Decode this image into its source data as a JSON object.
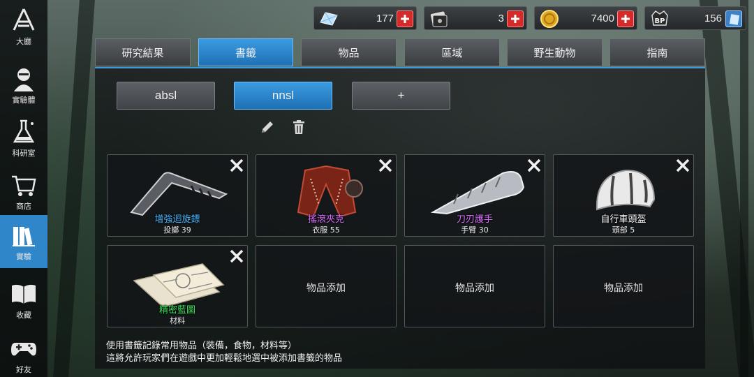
{
  "sidebar": {
    "items": [
      {
        "label": "大廳",
        "icon": "lobby-logo-icon"
      },
      {
        "label": "實驗體",
        "icon": "subject-portrait-icon"
      },
      {
        "label": "科研室",
        "icon": "flask-icon"
      },
      {
        "label": "商店",
        "icon": "shopping-cart-icon"
      },
      {
        "label": "實驗",
        "icon": "books-icon",
        "active": true
      },
      {
        "label": "收藏",
        "icon": "open-book-icon"
      },
      {
        "label": "好友",
        "icon": "gamepad-icon"
      }
    ]
  },
  "currency": [
    {
      "name": "crystal",
      "icon": "crystal-icon",
      "value": "177",
      "has_plus": true
    },
    {
      "name": "ticket",
      "icon": "ticket-card-icon",
      "value": "3",
      "has_plus": true
    },
    {
      "name": "coin",
      "icon": "gold-coin-icon",
      "value": "7400",
      "has_plus": true
    },
    {
      "name": "bp",
      "icon": "bp-badge-icon",
      "value": "156",
      "has_plus": false
    }
  ],
  "tabs": [
    {
      "label": "研究結果"
    },
    {
      "label": "書籤",
      "active": true
    },
    {
      "label": "物品"
    },
    {
      "label": "區域"
    },
    {
      "label": "野生動物"
    },
    {
      "label": "指南"
    }
  ],
  "bookmark_buttons": [
    {
      "label": "absl"
    },
    {
      "label": "nnsl",
      "active": true
    },
    {
      "label": "+"
    }
  ],
  "slots": [
    {
      "name": "增強迴旋鏢",
      "name_color": "#46b8ff",
      "sub": "投擲 39",
      "art": "boomerang"
    },
    {
      "name": "搖滾夾克",
      "name_color": "#d86bff",
      "sub": "衣服 55",
      "art": "jacket"
    },
    {
      "name": "刀刃護手",
      "name_color": "#d86bff",
      "sub": "手臂 30",
      "art": "bracer"
    },
    {
      "name": "自行車頭盔",
      "name_color": "#ffffff",
      "sub": "頭部 5",
      "art": "helmet"
    },
    {
      "name": "精密藍圖",
      "name_color": "#3ee05a",
      "sub": "材料",
      "art": "blueprint"
    },
    {
      "empty_label": "物品添加"
    },
    {
      "empty_label": "物品添加"
    },
    {
      "empty_label": "物品添加"
    }
  ],
  "description": {
    "line1": "使用書籤記錄常用物品（裝備，食物，材料等）",
    "line2": "這將允許玩家們在遊戲中更加輕鬆地選中被添加書籤的物品"
  },
  "colors": {
    "accent": "#2f86c9",
    "plus_red": "#d42a2a"
  }
}
